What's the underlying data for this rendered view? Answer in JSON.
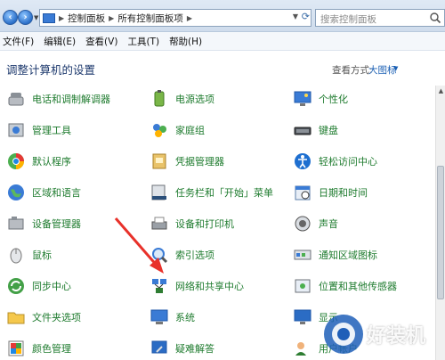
{
  "address": {
    "segments": [
      "控制面板",
      "所有控制面板项"
    ],
    "search_placeholder": "搜索控制面板"
  },
  "menu": [
    "文件(F)",
    "编辑(E)",
    "查看(V)",
    "工具(T)",
    "帮助(H)"
  ],
  "header": {
    "title": "调整计算机的设置",
    "view_label": "查看方式:",
    "view_value": "大图标"
  },
  "items": [
    [
      {
        "label": "电话和调制解调器",
        "icon": "phone-modem-icon"
      },
      {
        "label": "电源选项",
        "icon": "power-options-icon"
      },
      {
        "label": "个性化",
        "icon": "personalization-icon"
      }
    ],
    [
      {
        "label": "管理工具",
        "icon": "admin-tools-icon"
      },
      {
        "label": "家庭组",
        "icon": "homegroup-icon"
      },
      {
        "label": "键盘",
        "icon": "keyboard-icon"
      }
    ],
    [
      {
        "label": "默认程序",
        "icon": "default-programs-icon"
      },
      {
        "label": "凭据管理器",
        "icon": "credential-manager-icon"
      },
      {
        "label": "轻松访问中心",
        "icon": "ease-of-access-icon"
      }
    ],
    [
      {
        "label": "区域和语言",
        "icon": "region-language-icon"
      },
      {
        "label": "任务栏和「开始」菜单",
        "icon": "taskbar-start-icon"
      },
      {
        "label": "日期和时间",
        "icon": "date-time-icon"
      }
    ],
    [
      {
        "label": "设备管理器",
        "icon": "device-manager-icon"
      },
      {
        "label": "设备和打印机",
        "icon": "devices-printers-icon"
      },
      {
        "label": "声音",
        "icon": "sound-icon"
      }
    ],
    [
      {
        "label": "鼠标",
        "icon": "mouse-icon"
      },
      {
        "label": "索引选项",
        "icon": "indexing-options-icon"
      },
      {
        "label": "通知区域图标",
        "icon": "notification-area-icon"
      }
    ],
    [
      {
        "label": "同步中心",
        "icon": "sync-center-icon"
      },
      {
        "label": "网络和共享中心",
        "icon": "network-sharing-icon"
      },
      {
        "label": "位置和其他传感器",
        "icon": "location-sensors-icon"
      }
    ],
    [
      {
        "label": "文件夹选项",
        "icon": "folder-options-icon"
      },
      {
        "label": "系统",
        "icon": "system-icon"
      },
      {
        "label": "显示",
        "icon": "display-icon"
      }
    ],
    [
      {
        "label": "颜色管理",
        "icon": "color-management-icon"
      },
      {
        "label": "疑难解答",
        "icon": "troubleshooting-icon"
      },
      {
        "label": "用户帐户",
        "icon": "user-accounts-icon"
      }
    ]
  ],
  "watermark": "好装机"
}
